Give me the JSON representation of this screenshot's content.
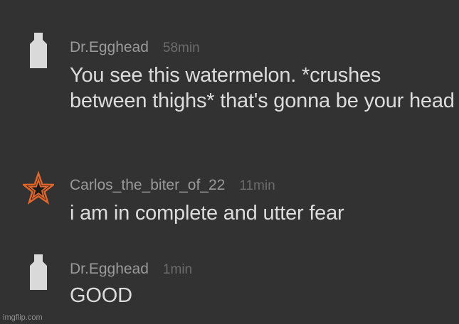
{
  "comments": [
    {
      "author": "Dr.Egghead",
      "time": "58min",
      "text": "You see this watermelon. *crushes between thighs* that's gonna be your head",
      "avatar_icon": "bottle-icon",
      "avatar_color": "#d9d9d9"
    },
    {
      "author": "Carlos_the_biter_of_22",
      "time": "11min",
      "text": "i am in complete and utter fear",
      "avatar_icon": "star-icon",
      "avatar_color": "#e0672c"
    },
    {
      "author": "Dr.Egghead",
      "time": "1min",
      "text": "GOOD",
      "avatar_icon": "bottle-icon",
      "avatar_color": "#d9d9d9"
    }
  ],
  "watermark": "imgflip.com",
  "colors": {
    "background": "#323232",
    "author": "#9a9a9a",
    "time": "#6c6c6c",
    "text": "#dcdcdc"
  }
}
